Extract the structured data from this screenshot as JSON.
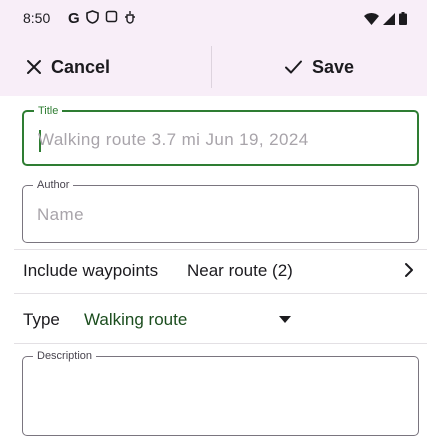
{
  "status_bar": {
    "time": "8:50",
    "left_icons": [
      "google-g-icon",
      "vpn-shield-icon",
      "screen-icon",
      "debug-icon"
    ],
    "right_icons": [
      "wifi-icon",
      "signal-icon",
      "battery-icon"
    ]
  },
  "action_bar": {
    "cancel_label": "Cancel",
    "save_label": "Save"
  },
  "title_field": {
    "label": "Title",
    "value": "",
    "placeholder": "Walking route 3.7 mi Jun 19, 2024"
  },
  "author_field": {
    "label": "Author",
    "value": "",
    "placeholder": "Name"
  },
  "waypoints_row": {
    "label": "Include waypoints",
    "value": "Near route (2)"
  },
  "type_row": {
    "label": "Type",
    "value": "Walking route"
  },
  "description_field": {
    "label": "Description",
    "value": "",
    "placeholder": ""
  },
  "colors": {
    "accent_green": "#2e7d32",
    "header_bg": "#f8eef8",
    "outline": "#7a757f"
  }
}
